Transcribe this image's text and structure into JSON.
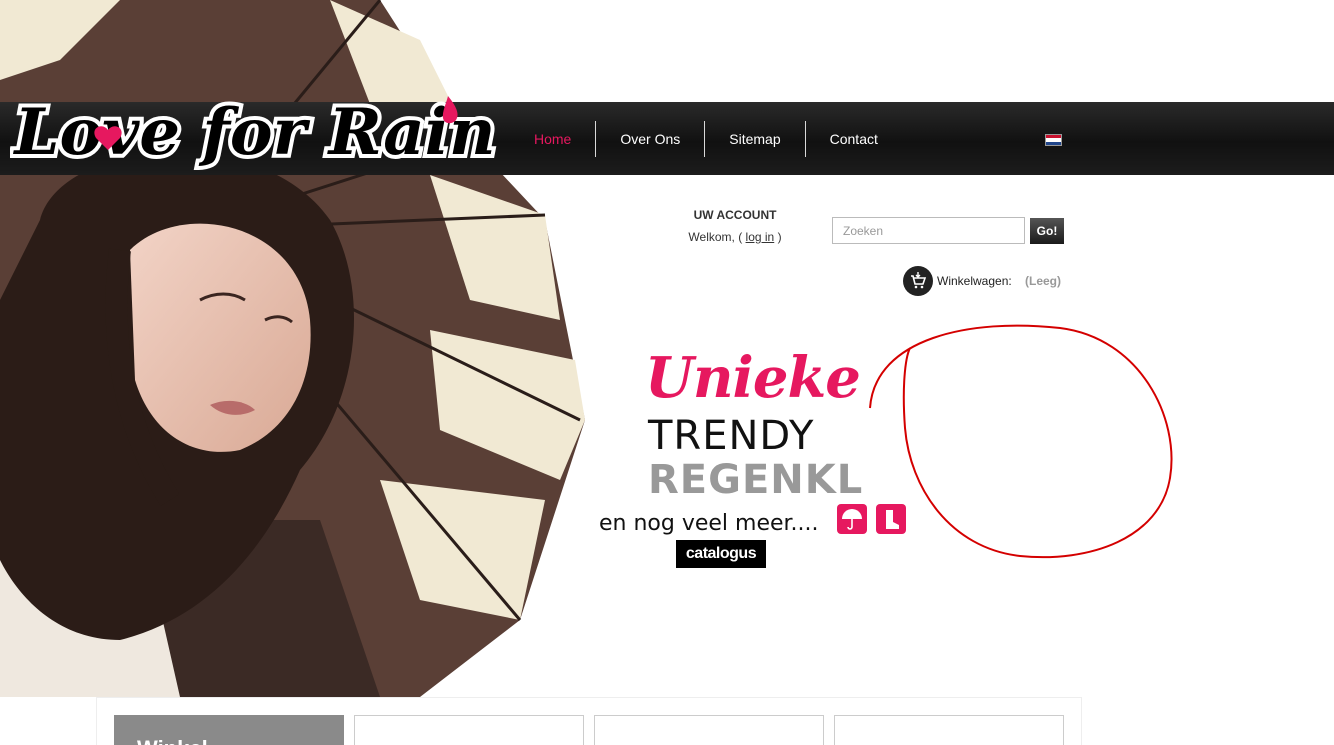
{
  "brand": {
    "logo_text": "Love for Rain",
    "accent_color": "#e6185f"
  },
  "nav": {
    "items": [
      {
        "label": "Home",
        "active": true
      },
      {
        "label": "Over Ons",
        "active": false
      },
      {
        "label": "Sitemap",
        "active": false
      },
      {
        "label": "Contact",
        "active": false
      }
    ],
    "language_flag": "dutch-flag-icon"
  },
  "account": {
    "title": "UW ACCOUNT",
    "welcome_prefix": "Welkom, (",
    "login_link": "log in",
    "welcome_suffix": ")"
  },
  "search": {
    "placeholder": "Zoeken",
    "button_label": "Go!"
  },
  "cart": {
    "label": "Winkelwagen:",
    "status": "(Leeg)",
    "icon": "cart-icon"
  },
  "banner": {
    "line1": "Unieke",
    "line2": "TRENDY",
    "line3": "REGENKL",
    "line4": "en nog veel meer....",
    "catalog_button": "catalogus",
    "icons": [
      "umbrella-icon",
      "boot-icon"
    ]
  },
  "tiles": {
    "first_title": "Winkel"
  }
}
